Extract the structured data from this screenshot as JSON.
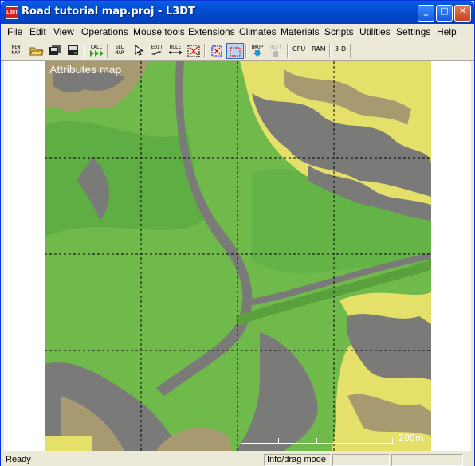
{
  "window": {
    "title": "Road tutorial map.proj - L3DT",
    "icon_text": "L3DT"
  },
  "title_buttons": {
    "minimize": "_",
    "maximize": "□",
    "close": "✕"
  },
  "menu": [
    "File",
    "Edit",
    "View",
    "Operations",
    "Mouse tools",
    "Extensions",
    "Climates",
    "Materials",
    "Scripts",
    "Utilities",
    "Settings",
    "Help"
  ],
  "toolbar": {
    "new_map": "NEW MAP",
    "calc": "CALC",
    "sel_map": "SEL MAP",
    "edit": "EDIT",
    "rule": "RULE",
    "bkup": "BKUP",
    "rest": "REST",
    "cpu": "CPU",
    "ram": "RAM",
    "three_d": "3-D"
  },
  "map": {
    "title": "Attributes map",
    "scale_label": "200m"
  },
  "status": {
    "left": "Ready",
    "mode": "Info/drag mode"
  },
  "colors": {
    "grass": "#6fba4a",
    "rock": "#7a7a78",
    "sand": "#e5e06a",
    "dirt": "#a89a70"
  }
}
